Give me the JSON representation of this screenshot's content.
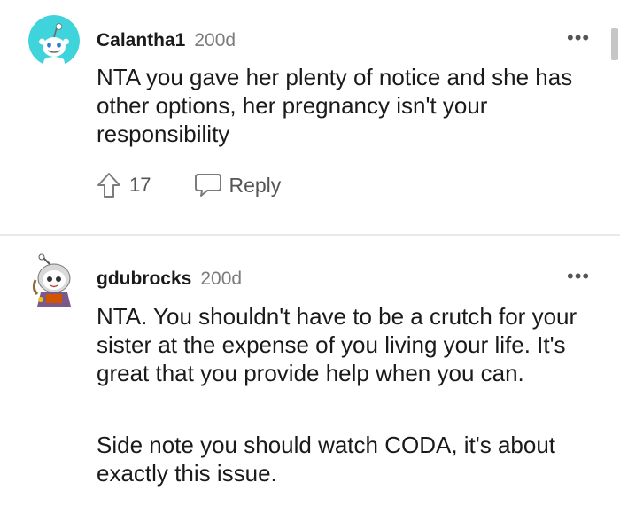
{
  "comments": [
    {
      "username": "Calantha1",
      "age": "200d",
      "more": "•••",
      "avatar_icon": "snoo-avatar-icon",
      "paragraphs": [
        "NTA you gave her plenty of notice and she has other options, her pregnancy isn't your responsibility"
      ],
      "votes": "17",
      "reply_label": "Reply"
    },
    {
      "username": "gdubrocks",
      "age": "200d",
      "more": "•••",
      "avatar_icon": "custom-snoo-avatar-icon",
      "paragraphs": [
        "NTA. You shouldn't have to be a crutch for your sister at the expense of you living your life. It's great that you provide help when you can.",
        "Side note you should watch CODA, it's about exactly this issue."
      ]
    }
  ],
  "colors": {
    "avatar_bg": "#3fd3dc",
    "text": "#1a1a1b",
    "muted": "#7c7c7c"
  }
}
